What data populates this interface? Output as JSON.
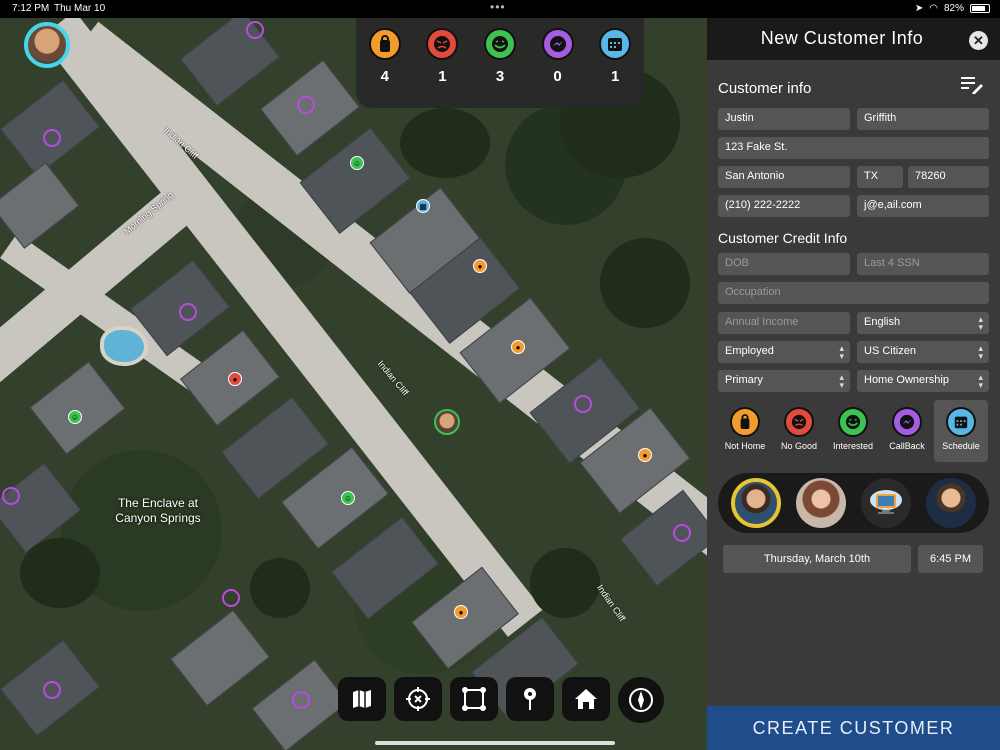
{
  "status_bar": {
    "time": "7:12 PM",
    "date": "Thu Mar 10",
    "battery": "82%",
    "battery_level": 0.82
  },
  "map": {
    "street_labels": [
      "Indian Cliff",
      "Morning Spring",
      "Indian Cliff",
      "Indian Cliff"
    ],
    "area_label_line1": "The Enclave at",
    "area_label_line2": "Canyon Springs"
  },
  "counters": [
    {
      "name": "not-home",
      "icon": "door-hanger-icon",
      "color": "#f39c2b",
      "count": "4"
    },
    {
      "name": "no-good",
      "icon": "angry-face-icon",
      "color": "#e24a3b",
      "count": "1"
    },
    {
      "name": "interested",
      "icon": "smile-face-icon",
      "color": "#3cc24e",
      "count": "3"
    },
    {
      "name": "callback",
      "icon": "messenger-icon",
      "color": "#a45de0",
      "count": "0"
    },
    {
      "name": "schedule",
      "icon": "calendar-icon",
      "color": "#5bb6e8",
      "count": "1"
    }
  ],
  "toolbar": [
    "map-icon",
    "locate-icon",
    "polygon-icon",
    "pin-icon",
    "home-icon",
    "compass-icon"
  ],
  "panel": {
    "title": "New Customer Info",
    "customer_info_title": "Customer info",
    "first_name": "Justin",
    "last_name": "Griffith",
    "address": "123 Fake St.",
    "city": "San Antonio",
    "state": "TX",
    "zip": "78260",
    "phone": "(210) 222-2222",
    "email": "j@e,ail.com",
    "credit_title": "Customer Credit Info",
    "dob_placeholder": "DOB",
    "ssn_placeholder": "Last 4 SSN",
    "occupation_placeholder": "Occupation",
    "income_placeholder": "Annual Income",
    "language": "English",
    "employment": "Employed",
    "citizenship": "US Citizen",
    "applicant": "Primary",
    "ownership": "Home Ownership",
    "statuses": [
      {
        "label": "Not Home",
        "color": "#f39c2b",
        "icon": "door-hanger-icon",
        "selected": false
      },
      {
        "label": "No Good",
        "color": "#e24a3b",
        "icon": "angry-face-icon",
        "selected": false
      },
      {
        "label": "Interested",
        "color": "#3cc24e",
        "icon": "smile-face-icon",
        "selected": false
      },
      {
        "label": "CallBack",
        "color": "#a45de0",
        "icon": "messenger-icon",
        "selected": false
      },
      {
        "label": "Schedule",
        "color": "#5bb6e8",
        "icon": "calendar-icon",
        "selected": true
      }
    ],
    "appointment_date": "Thursday, March 10th",
    "appointment_time": "6:45 PM",
    "create_button": "CREATE CUSTOMER"
  }
}
